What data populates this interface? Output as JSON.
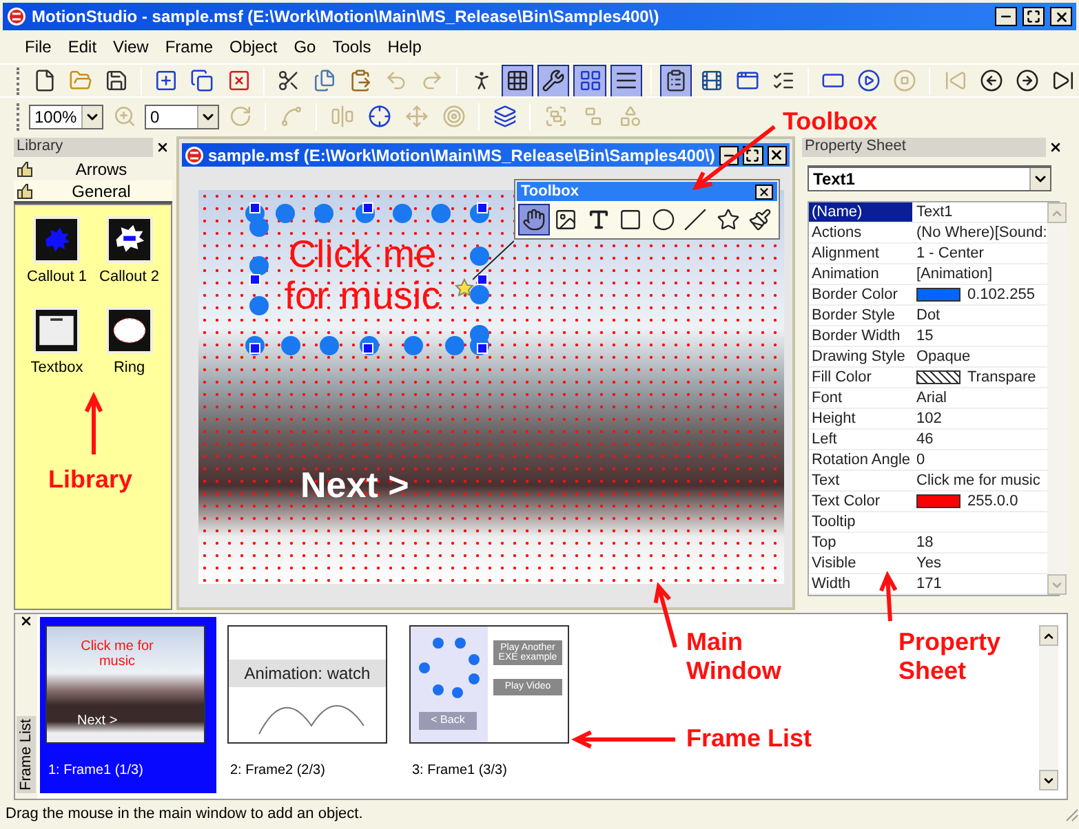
{
  "window": {
    "title": "MotionStudio - sample.msf (E:\\Work\\Motion\\Main\\MS_Release\\Bin\\Samples400\\)"
  },
  "menu": [
    "File",
    "Edit",
    "View",
    "Frame",
    "Object",
    "Go",
    "Tools",
    "Help"
  ],
  "toolbar_1": [
    {
      "kind": "new",
      "pressed": false,
      "disabled": false
    },
    {
      "kind": "open",
      "pressed": false,
      "disabled": false
    },
    {
      "kind": "save",
      "pressed": false,
      "disabled": false
    },
    {
      "kind": "sep"
    },
    {
      "kind": "frame-add",
      "pressed": false,
      "disabled": false
    },
    {
      "kind": "frame-copy",
      "pressed": false,
      "disabled": false
    },
    {
      "kind": "frame-delete",
      "pressed": false,
      "disabled": false
    },
    {
      "kind": "sep"
    },
    {
      "kind": "cut",
      "pressed": false,
      "disabled": false
    },
    {
      "kind": "copy",
      "pressed": false,
      "disabled": false
    },
    {
      "kind": "paste",
      "pressed": false,
      "disabled": false
    },
    {
      "kind": "undo",
      "pressed": false,
      "disabled": true
    },
    {
      "kind": "redo",
      "pressed": false,
      "disabled": true
    },
    {
      "kind": "sep"
    },
    {
      "kind": "run",
      "pressed": false,
      "disabled": false
    },
    {
      "kind": "grid",
      "pressed": true,
      "disabled": false
    },
    {
      "kind": "tools",
      "pressed": true,
      "disabled": false
    },
    {
      "kind": "snap",
      "pressed": true,
      "disabled": false
    },
    {
      "kind": "list",
      "pressed": true,
      "disabled": false
    },
    {
      "kind": "sep"
    },
    {
      "kind": "properties",
      "pressed": true,
      "disabled": false
    },
    {
      "kind": "film",
      "pressed": false,
      "disabled": false
    },
    {
      "kind": "windows",
      "pressed": false,
      "disabled": false
    },
    {
      "kind": "checklist",
      "pressed": false,
      "disabled": false
    },
    {
      "kind": "sep"
    },
    {
      "kind": "exe",
      "pressed": false,
      "disabled": false
    },
    {
      "kind": "play",
      "pressed": false,
      "disabled": false
    },
    {
      "kind": "stop",
      "pressed": false,
      "disabled": true
    },
    {
      "kind": "sep"
    },
    {
      "kind": "first",
      "pressed": false,
      "disabled": true
    },
    {
      "kind": "prev",
      "pressed": false,
      "disabled": false
    },
    {
      "kind": "next",
      "pressed": false,
      "disabled": false
    },
    {
      "kind": "last",
      "pressed": false,
      "disabled": false
    }
  ],
  "toolbar_2": [
    {
      "kind": "combo",
      "value": "100%"
    },
    {
      "kind": "zoom",
      "pressed": false,
      "disabled": true
    },
    {
      "kind": "combo",
      "value": "0"
    },
    {
      "kind": "rotate",
      "pressed": false,
      "disabled": true
    },
    {
      "kind": "sep"
    },
    {
      "kind": "polygon",
      "pressed": false,
      "disabled": true
    },
    {
      "kind": "sep"
    },
    {
      "kind": "align",
      "pressed": false,
      "disabled": true
    },
    {
      "kind": "center",
      "pressed": false,
      "disabled": false
    },
    {
      "kind": "distribute",
      "pressed": false,
      "disabled": true
    },
    {
      "kind": "position",
      "pressed": false,
      "disabled": true
    },
    {
      "kind": "sep"
    },
    {
      "kind": "order",
      "pressed": false,
      "disabled": false
    },
    {
      "kind": "sep"
    },
    {
      "kind": "group",
      "pressed": false,
      "disabled": true
    },
    {
      "kind": "ungroup",
      "pressed": false,
      "disabled": true
    },
    {
      "kind": "shape",
      "pressed": false,
      "disabled": true
    }
  ],
  "library": {
    "title": "Library",
    "categories": [
      {
        "label": "Arrows",
        "selected": false
      },
      {
        "label": "General",
        "selected": true
      }
    ],
    "items": [
      {
        "kind": "burst",
        "label": "Callout 1"
      },
      {
        "kind": "burst-box",
        "label": "Callout 2"
      },
      {
        "kind": "textbox",
        "label": "Textbox"
      },
      {
        "kind": "ring",
        "label": "Ring"
      }
    ]
  },
  "main_window": {
    "title": "sample.msf (E:\\Work\\Motion\\Main\\MS_Release\\Bin\\Samples400\\)",
    "canvas": {
      "text": "Click me for music",
      "button": "Next >"
    }
  },
  "toolbox": {
    "title": "Toolbox",
    "tools": [
      {
        "kind": "hand",
        "selected": true
      },
      {
        "kind": "image",
        "selected": false
      },
      {
        "kind": "text",
        "selected": false
      },
      {
        "kind": "rectangle",
        "selected": false
      },
      {
        "kind": "ellipse",
        "selected": false
      },
      {
        "kind": "line",
        "selected": false
      },
      {
        "kind": "star",
        "selected": false
      },
      {
        "kind": "brush",
        "selected": false
      }
    ]
  },
  "property_sheet": {
    "title": "Property Sheet",
    "object": "Text1",
    "rows": [
      {
        "name": "(Name)",
        "value": "Text1",
        "selected": true
      },
      {
        "name": "Actions",
        "value": "(No Where)[Sound:",
        "selected": false
      },
      {
        "name": "Alignment",
        "value": "1 - Center",
        "selected": false
      },
      {
        "name": "Animation",
        "value": "[Animation]",
        "selected": false
      },
      {
        "name": "Border Color",
        "value": "0.102.255",
        "selected": false,
        "kind": "color",
        "color": "#0066ff"
      },
      {
        "name": "Border Style",
        "value": "Dot",
        "selected": false
      },
      {
        "name": "Border Width",
        "value": "15",
        "selected": false
      },
      {
        "name": "Drawing Style",
        "value": "Opaque",
        "selected": false
      },
      {
        "name": "Fill Color",
        "value": "Transpare",
        "selected": false,
        "kind": "hatch"
      },
      {
        "name": "Font",
        "value": "Arial",
        "selected": false
      },
      {
        "name": "Height",
        "value": "102",
        "selected": false
      },
      {
        "name": "Left",
        "value": "46",
        "selected": false
      },
      {
        "name": "Rotation Angle",
        "value": "0",
        "selected": false
      },
      {
        "name": "Text",
        "value": "Click me for music",
        "selected": false
      },
      {
        "name": "Text Color",
        "value": "255.0.0",
        "selected": false,
        "kind": "color",
        "color": "#ff0000"
      },
      {
        "name": "Tooltip",
        "value": "",
        "selected": false
      },
      {
        "name": "Top",
        "value": "18",
        "selected": false
      },
      {
        "name": "Visible",
        "value": "Yes",
        "selected": false
      },
      {
        "name": "Width",
        "value": "171",
        "selected": false
      }
    ]
  },
  "frame_list": {
    "title": "Frame List",
    "frames": [
      {
        "kind": "photo",
        "label": "1: Frame1 (1/3)",
        "selected": true,
        "texts": [
          "Click me for music",
          "Next >"
        ]
      },
      {
        "kind": "animation",
        "label": "2: Frame2 (2/3)",
        "selected": false,
        "texts": [
          "Animation: watch"
        ]
      },
      {
        "kind": "menu",
        "label": "3: Frame1 (3/3)",
        "selected": false,
        "texts": [
          "Play Another EXE example",
          "Play Video",
          "< Back"
        ]
      }
    ]
  },
  "annotations": [
    "Toolbox",
    "Library",
    "Main Window",
    "Property Sheet",
    "Frame List"
  ],
  "status_bar": "Drag the mouse in the main window to add an object."
}
